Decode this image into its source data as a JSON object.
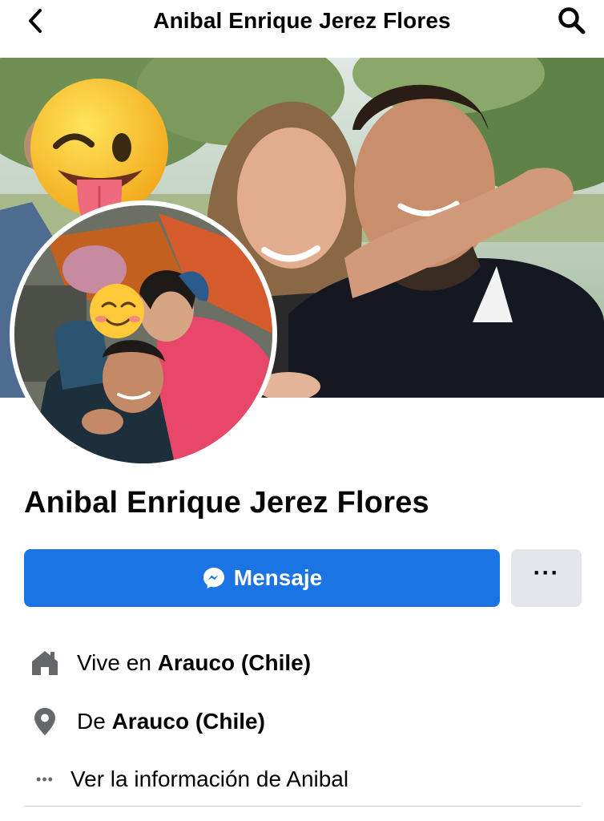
{
  "header": {
    "title": "Anibal Enrique Jerez Flores",
    "back_icon": "chevron-left-icon",
    "search_icon": "search-icon"
  },
  "profile": {
    "name": "Anibal Enrique Jerez Flores"
  },
  "actions": {
    "message_label": "Mensaje",
    "message_icon": "messenger-icon",
    "more_icon": "more-dots-icon",
    "more_label": "···"
  },
  "info": [
    {
      "icon": "home-icon",
      "prefix": "Vive en ",
      "value": "Arauco (Chile)"
    },
    {
      "icon": "location-pin-icon",
      "prefix": "De ",
      "value": "Arauco (Chile)"
    },
    {
      "icon": "more-horizontal-icon",
      "icon_text": "•••",
      "prefix": "Ver la información de Anibal",
      "value": ""
    }
  ],
  "colors": {
    "accent": "#1b74e4",
    "secondary_button": "#e4e6eb",
    "text": "#050505",
    "icon_gray": "#65676b"
  }
}
